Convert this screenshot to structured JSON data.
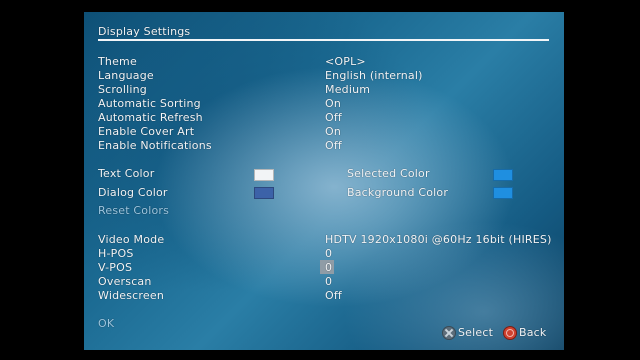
{
  "header": {
    "title": "Display Settings"
  },
  "settings": [
    {
      "label": "Theme",
      "value": "<OPL>"
    },
    {
      "label": "Language",
      "value": "English (internal)"
    },
    {
      "label": "Scrolling",
      "value": "Medium"
    },
    {
      "label": "Automatic Sorting",
      "value": "On"
    },
    {
      "label": "Automatic Refresh",
      "value": "Off"
    },
    {
      "label": "Enable Cover Art",
      "value": "On"
    },
    {
      "label": "Enable Notifications",
      "value": "Off"
    }
  ],
  "colors": {
    "text_color": {
      "label": "Text Color",
      "hex": "#f2f4f6"
    },
    "selected_color": {
      "label": "Selected Color",
      "hex": "#1f8fe0"
    },
    "dialog_color": {
      "label": "Dialog Color",
      "hex": "#3c62a8"
    },
    "background_color": {
      "label": "Background Color",
      "hex": "#1f8fe0"
    },
    "reset_label": "Reset Colors"
  },
  "video": [
    {
      "label": "Video Mode",
      "value": "HDTV 1920x1080i @60Hz 16bit (HIRES)"
    },
    {
      "label": "H-POS",
      "value": "0"
    },
    {
      "label": "V-POS",
      "value": "0"
    },
    {
      "label": "Overscan",
      "value": "0"
    },
    {
      "label": "Widescreen",
      "value": "Off"
    }
  ],
  "ok_label": "OK",
  "footer": {
    "select_label": "Select",
    "back_label": "Back"
  }
}
